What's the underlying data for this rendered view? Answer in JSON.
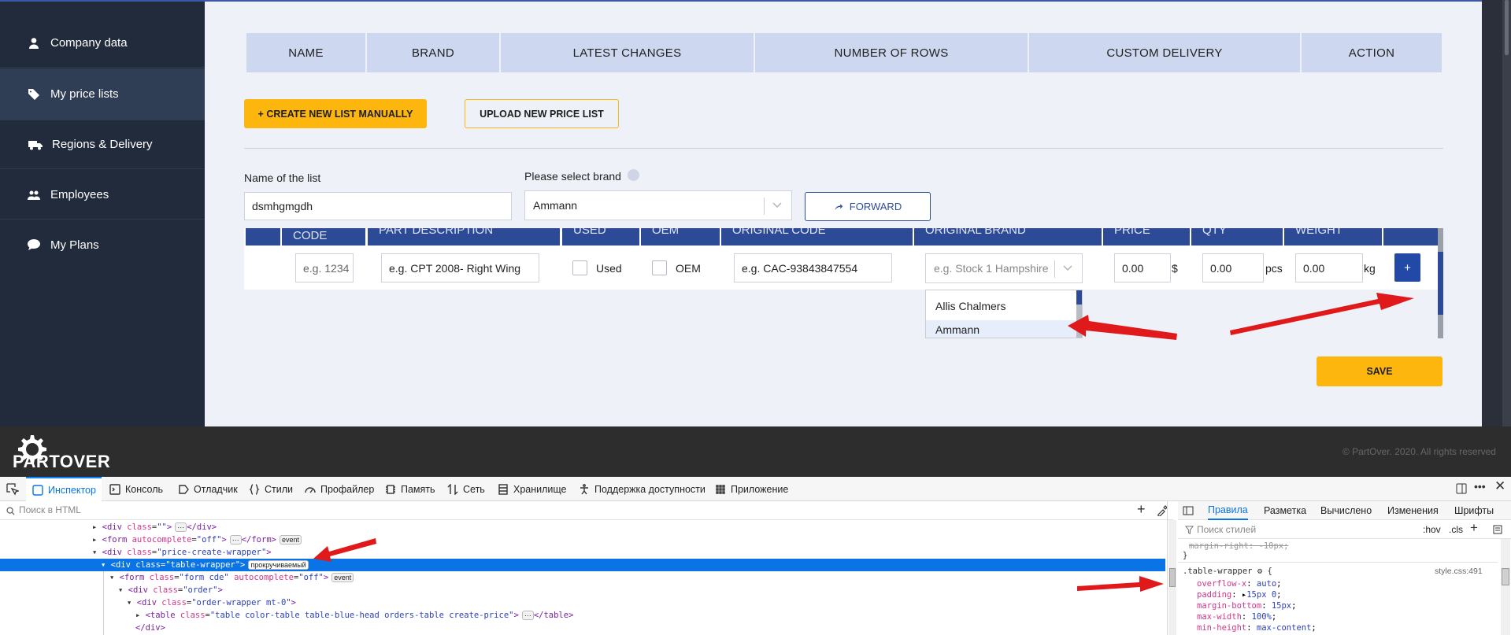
{
  "sidebar": {
    "items": [
      {
        "label": "Company data",
        "icon": "user-icon",
        "active": false
      },
      {
        "label": "My price lists",
        "icon": "tags-icon",
        "active": true
      },
      {
        "label": "Regions & Delivery",
        "icon": "truck-icon",
        "active": false
      },
      {
        "label": "Employees",
        "icon": "users-icon",
        "active": false
      },
      {
        "label": "My Plans",
        "icon": "chat-icon",
        "active": false
      }
    ]
  },
  "lists_table": {
    "headers": [
      "NAME",
      "BRAND",
      "LATEST CHANGES",
      "NUMBER OF ROWS",
      "CUSTOM DELIVERY",
      "ACTION"
    ]
  },
  "actions": {
    "create_manually": "+ CREATE NEW LIST MANUALLY",
    "upload": "UPLOAD NEW PRICE LIST"
  },
  "form": {
    "name_label": "Name of the list",
    "name_value": "dsmhgmgdh",
    "brand_label": "Please select brand",
    "brand_value": "Ammann",
    "forward_label": "FORWARD"
  },
  "items_table": {
    "headers": [
      "CODE",
      "PART DESCRIPTION",
      "USED",
      "OEM",
      "ORIGINAL CODE",
      "ORIGINAL BRAND",
      "PRICE",
      "QTY",
      "WEIGHT"
    ],
    "row": {
      "code_placeholder": "e.g. 1234",
      "description_placeholder": "e.g. CPT 2008- Right Wing",
      "used_label": "Used",
      "oem_label": "OEM",
      "original_code_placeholder": "e.g. CAC-93843847554",
      "original_brand_placeholder": "e.g. Stock 1 Hampshire",
      "price_value": "0.00",
      "price_unit": "$",
      "qty_value": "0.00",
      "qty_unit": "pcs",
      "weight_value": "0.00",
      "weight_unit": "kg",
      "add_label": "+"
    },
    "brand_dropdown": [
      "Allis Chalmers",
      "Ammann"
    ]
  },
  "save_label": "SAVE",
  "footer": {
    "logo": "PARTOVER",
    "copyright": "© PartOver. 2020. All rights reserved"
  },
  "devtools": {
    "tabs": [
      "Инспектор",
      "Консоль",
      "Отладчик",
      "Стили",
      "Профайлер",
      "Память",
      "Сеть",
      "Хранилище",
      "Поддержка доступности",
      "Приложение"
    ],
    "search_placeholder": "Поиск в HTML",
    "rules_tabs": [
      "Правила",
      "Разметка",
      "Вычислено",
      "Изменения",
      "Шрифты"
    ],
    "styles_filter_placeholder": "Поиск стилей",
    "styles_toggles": [
      ":hov",
      ".cls"
    ],
    "rule": {
      "prev_text": "margin-right: -10px;",
      "selector": ".table-wrapper",
      "source": "style.css:491",
      "props": [
        {
          "name": "overflow-x",
          "value": "auto"
        },
        {
          "name": "padding",
          "value": "15px 0"
        },
        {
          "name": "margin-bottom",
          "value": "15px"
        },
        {
          "name": "max-width",
          "value": "100%"
        },
        {
          "name": "min-height",
          "value": "max-content"
        }
      ]
    },
    "badges": {
      "event": "event",
      "scrollable": "прокручиваемый"
    }
  },
  "colors": {
    "sidebar": "#222b3c",
    "accent_yellow": "#fcb60e",
    "table_head_blue": "#2c4a96",
    "header_light": "#cdd7ef",
    "arrow_red": "#e0191b"
  }
}
